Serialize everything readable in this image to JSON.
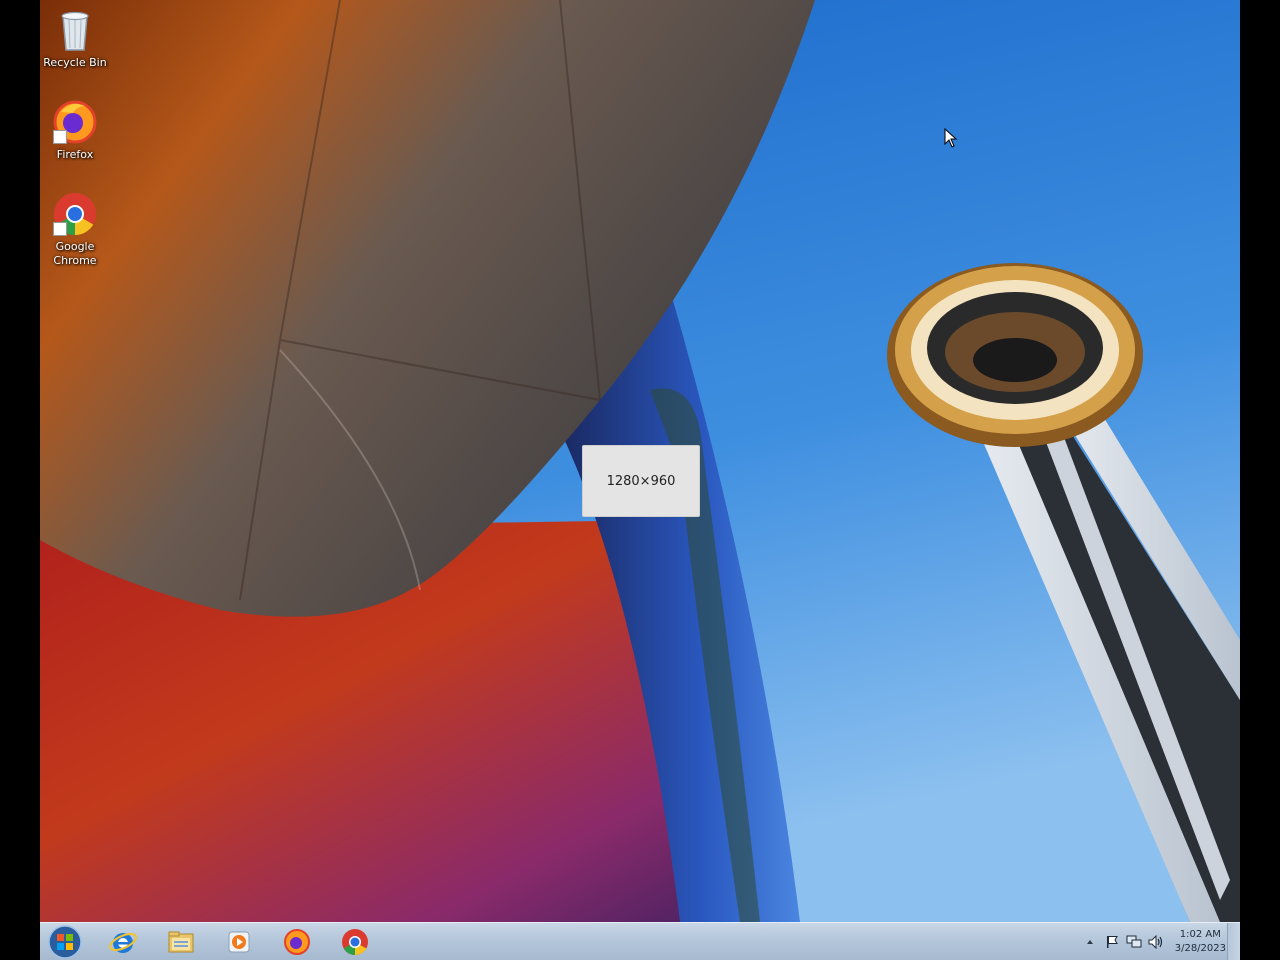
{
  "desktop": {
    "icons": [
      {
        "label": "Recycle Bin",
        "icon": "recycle-bin-icon"
      },
      {
        "label": "Firefox",
        "icon": "firefox-icon"
      },
      {
        "label": "Google Chrome",
        "icon": "chrome-icon"
      }
    ],
    "overlay_text": "1280×960"
  },
  "taskbar": {
    "start_icon": "windows-start-icon",
    "pinned": [
      {
        "name": "Internet Explorer",
        "icon": "internet-explorer-icon"
      },
      {
        "name": "Windows Explorer",
        "icon": "file-explorer-icon"
      },
      {
        "name": "Windows Media Player",
        "icon": "media-player-icon"
      },
      {
        "name": "Firefox",
        "icon": "firefox-icon"
      },
      {
        "name": "Google Chrome",
        "icon": "chrome-icon"
      }
    ],
    "tray": {
      "icons": [
        "show-hidden-icons-chevron",
        "action-center-flag-icon",
        "network-icon",
        "volume-icon"
      ],
      "time": "1:02 AM",
      "date": "3/28/2023"
    }
  },
  "colors": {
    "sky_top": "#1c6fd0",
    "sky_bottom": "#7fb6ec",
    "taskbar": "#b4c6da",
    "overlay_box": "#e4e4e4"
  }
}
